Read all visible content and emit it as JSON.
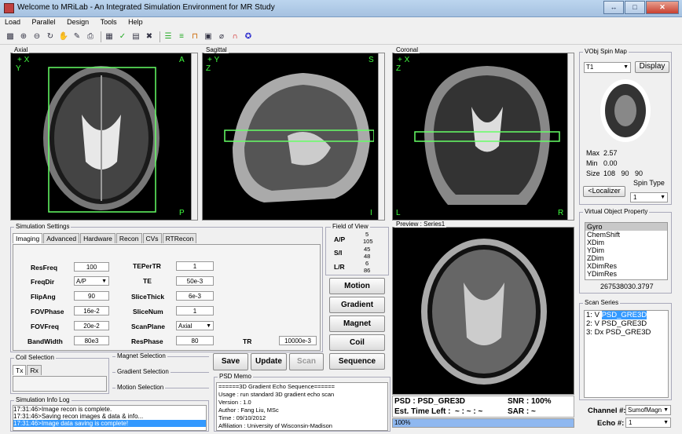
{
  "window": {
    "title": "Welcome to MRiLab - An Integrated Simulation Environment for MR Study",
    "min": "↔",
    "max": "□",
    "close": "✕"
  },
  "menu": [
    "Load",
    "Parallel",
    "Design",
    "Tools",
    "Help"
  ],
  "toolbar_icons": [
    "save-icon",
    "zoom-in-icon",
    "zoom-out-icon",
    "rotate-icon",
    "pan-icon",
    "datacursor-icon",
    "print-icon",
    "grid-icon",
    "check-icon",
    "table-icon",
    "tools-icon",
    "bars-icon",
    "coil-icon",
    "pulse-icon",
    "matrix-icon",
    "plot-icon",
    "magnet-icon",
    "run-icon"
  ],
  "axial": {
    "label": "Axial",
    "tl": "+ X",
    "tl2": "Y",
    "tr": "A",
    "bl": "",
    "br": "P"
  },
  "sagittal": {
    "label": "Sagittal",
    "tl": "+ Y",
    "tl2": "Z",
    "tr": "S",
    "br": "I"
  },
  "coronal": {
    "label": "Coronal",
    "tl": "+ X",
    "tl2": "Z",
    "bl": "L",
    "br": "R"
  },
  "spinmap": {
    "label": "VObj Spin Map",
    "select": "T1",
    "display": "Display",
    "max_label": "Max",
    "max": "2.57",
    "min_label": "Min",
    "min": "0.00",
    "size_label": "Size",
    "size": "108   90   90",
    "spin_type_label": "Spin Type",
    "localizer": "<Localizer",
    "spin_type": "1"
  },
  "vprop": {
    "label": "Virtual Object Property",
    "items": [
      "Gyro",
      "ChemShift",
      "XDim",
      "YDim",
      "ZDim",
      "XDimRes",
      "YDimRes"
    ],
    "value": "267538030.3797"
  },
  "series": {
    "label": "Scan Series",
    "rows": [
      {
        "num": "1:",
        "v": "V",
        "name": "PSD_GRE3D"
      },
      {
        "num": "2:",
        "v": "V",
        "name": "PSD_GRE3D"
      },
      {
        "num": "3:",
        "v": "Dx",
        "name": "PSD_GRE3D"
      }
    ]
  },
  "channel": {
    "label": "Channel #:",
    "value": "SumofMagn",
    "echo_label": "Echo #:",
    "echo": "1"
  },
  "settings": {
    "label": "Simulation Settings",
    "tabs": [
      "Imaging",
      "Advanced",
      "Hardware",
      "Recon",
      "CVs",
      "RTRecon"
    ],
    "fields_left": [
      {
        "name": "ResFreq",
        "value": "100"
      },
      {
        "name": "FreqDir",
        "value": "A/P"
      },
      {
        "name": "FlipAng",
        "value": "90"
      },
      {
        "name": "FOVPhase",
        "value": "16e-2"
      },
      {
        "name": "FOVFreq",
        "value": "20e-2"
      },
      {
        "name": "BandWidth",
        "value": "80e3"
      }
    ],
    "fields_right": [
      {
        "name": "TEPerTR",
        "value": "1"
      },
      {
        "name": "TE",
        "value": "50e-3"
      },
      {
        "name": "SliceThick",
        "value": "6e-3"
      },
      {
        "name": "SliceNum",
        "value": "1"
      },
      {
        "name": "ScanPlane",
        "value": "Axial"
      },
      {
        "name": "ResPhase",
        "value": "80"
      }
    ],
    "tr_label": "TR",
    "tr_value": "10000e-3"
  },
  "fov": {
    "label": "Field of View",
    "rows": [
      {
        "axis": "A/P",
        "a": "5",
        "b": "105"
      },
      {
        "axis": "S/I",
        "a": "45",
        "b": "48"
      },
      {
        "axis": "L/R",
        "a": "6",
        "b": "86"
      }
    ]
  },
  "actions": [
    "Motion",
    "Gradient",
    "Magnet",
    "Coil",
    "Sequence"
  ],
  "coil": {
    "label": "Coil Selection",
    "tabs": [
      "Tx",
      "Rx"
    ]
  },
  "magnet_sel": "Magnet Selection",
  "gradient_sel": "Gradient Selection",
  "motion_sel": "Motion Selection",
  "controls": {
    "save": "Save",
    "update": "Update",
    "scan": "Scan"
  },
  "log": {
    "label": "Simulation Info Log",
    "lines": [
      "17:31:46>Image recon is complete.",
      "17:31:46>Saving recon images & data & info...",
      "17:31:46>Image data saving is complete!"
    ]
  },
  "memo": {
    "label": "PSD Memo",
    "lines": [
      "======3D Gradient Echo Sequence======",
      "Usage : run standard 3D gradient echo scan",
      "Version : 1.0",
      "Author : Fang Liu, MSc",
      "Time : 09/10/2012",
      "Affiliation : University of Wisconsin-Madison"
    ]
  },
  "preview": {
    "label": "Preview : Series1",
    "psd_label": "PSD : PSD_GRE3D",
    "snr": "SNR : 100%",
    "time": "Est. Time Left :  ~ : ~ : ~",
    "sar": "SAR : ~",
    "progress_text": "100%",
    "progress": 1.0
  }
}
